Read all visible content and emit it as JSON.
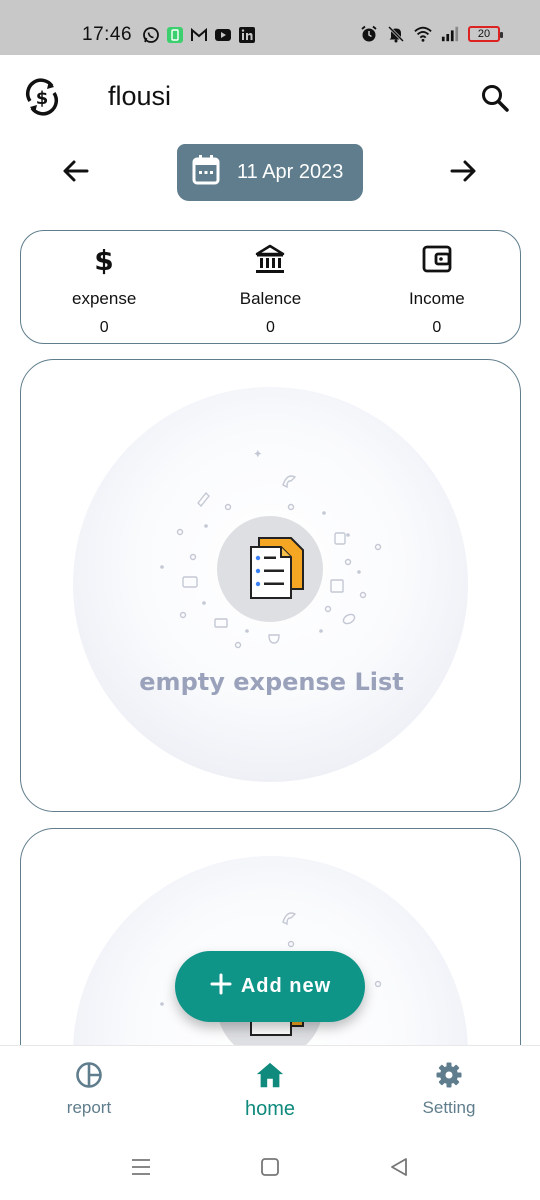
{
  "status_bar": {
    "time": "17:46",
    "battery": "20",
    "left_icons": [
      "whatsapp-icon",
      "battery-saver-icon",
      "gmail-icon",
      "youtube-icon",
      "linkedin-icon"
    ],
    "right_icons": [
      "alarm-icon",
      "mute-icon",
      "wifi-icon",
      "signal-icon",
      "battery-icon"
    ]
  },
  "app_bar": {
    "title": "flousi",
    "logo_icon": "currency-sync-icon",
    "search_icon": "search-icon"
  },
  "date_nav": {
    "date": "11 Apr 2023",
    "prev_icon": "arrow-left-icon",
    "next_icon": "arrow-right-icon",
    "calendar_icon": "calendar-icon"
  },
  "summary": [
    {
      "label": "expense",
      "value": "0",
      "icon": "dollar-icon"
    },
    {
      "label": "Balence",
      "value": "0",
      "icon": "bank-icon"
    },
    {
      "label": "Income",
      "value": "0",
      "icon": "wallet-icon"
    }
  ],
  "empty_state": {
    "text": "empty expense List",
    "icon": "document-list-icon"
  },
  "fab": {
    "label": "Add new",
    "icon": "plus-icon"
  },
  "bottom_nav": [
    {
      "label": "report",
      "icon": "pie-chart-icon",
      "active": false
    },
    {
      "label": "home",
      "icon": "home-icon",
      "active": true
    },
    {
      "label": "Setting",
      "icon": "gear-icon",
      "active": false
    }
  ],
  "colors": {
    "accent": "#0f9488",
    "slate": "#5f7d8c",
    "empty_text": "#9aa2bb",
    "status_bar": "#c8c8c8"
  }
}
